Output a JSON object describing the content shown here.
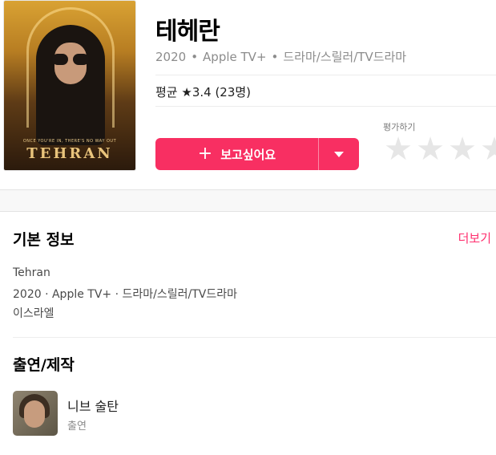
{
  "poster": {
    "tagline": "ONCE YOU'RE IN, THERE'S NO WAY OUT",
    "title": "TEHRAN"
  },
  "title": "테헤란",
  "meta": {
    "year": "2020",
    "network": "Apple TV+",
    "genre": "드라마/스릴러/TV드라마",
    "separator": "•"
  },
  "rating": {
    "text": "평균 ★3.4 (23명)",
    "average": 3.4,
    "count": 23
  },
  "wishlist": {
    "plus": "+",
    "label": "보고싶어요",
    "accent": "#f82f62"
  },
  "rate": {
    "label": "평가하기",
    "stars": [
      "★",
      "★",
      "★",
      "★"
    ],
    "star_color": "#e6e6e6"
  },
  "basic_info": {
    "heading": "기본 정보",
    "more": "더보기",
    "original_title": "Tehran",
    "summary": "2020 · Apple TV+ · 드라마/스릴러/TV드라마",
    "country": "이스라엘"
  },
  "cast": {
    "heading": "출연/제작",
    "items": [
      {
        "name": "니브 술탄",
        "role": "출연"
      }
    ]
  }
}
